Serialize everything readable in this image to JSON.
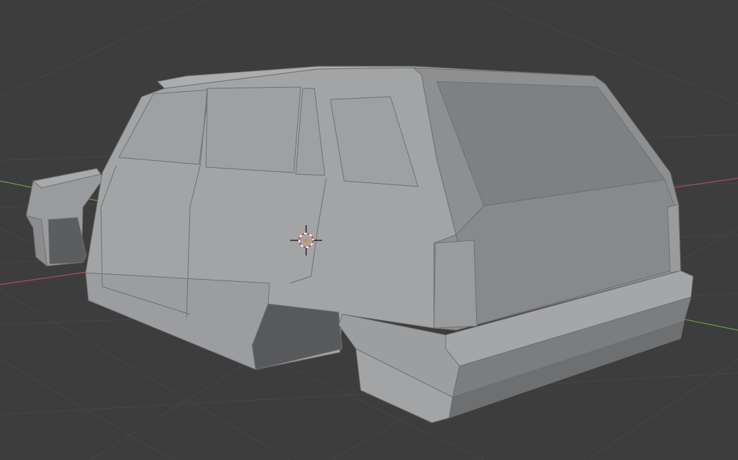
{
  "viewport": {
    "background": "#3d3d3d",
    "grid_color": "#4a4a4a",
    "x_axis_color": "#b34d5a",
    "y_axis_color": "#6aa33a",
    "shading": "solid",
    "object_name": "car-body-mesh",
    "icons": {
      "cursor": "3d-cursor-icon",
      "x_axis": "x-axis-line",
      "y_axis": "y-axis-line"
    },
    "mesh_colors": {
      "light": "#a4a5a6",
      "mid": "#96979a",
      "dark": "#7e7f81",
      "shadow": "#5a5b5c",
      "edge": "#6d6e70"
    }
  }
}
